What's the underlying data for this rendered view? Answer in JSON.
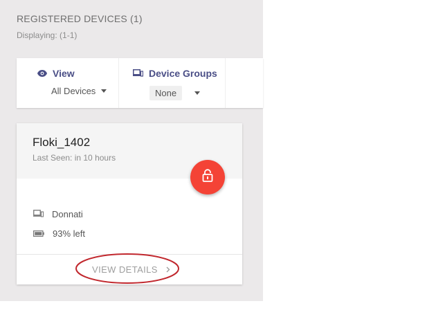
{
  "header": {
    "title": "REGISTERED DEVICES (1)",
    "subtitle": "Displaying: (1-1)"
  },
  "filters": {
    "view": {
      "label": "View",
      "value": "All Devices",
      "icon": "eye-icon"
    },
    "groups": {
      "label": "Device Groups",
      "value": "None",
      "icon": "device-groups-icon"
    }
  },
  "device": {
    "name": "Floki_1402",
    "last_seen": "Last Seen: in 10 hours",
    "owner": "Donnati",
    "battery": "93% left",
    "action_icon": "unlocked-padlock-icon",
    "details_label": "VIEW DETAILS"
  },
  "colors": {
    "accent": "#4a4e86",
    "lock_button": "#f44336",
    "annotation": "#c1272d",
    "panel_bg": "#ebe9ea"
  }
}
